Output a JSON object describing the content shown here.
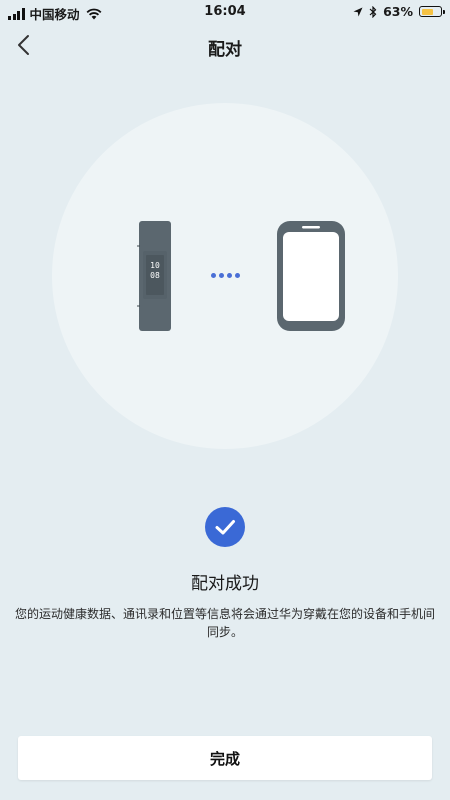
{
  "status_bar": {
    "carrier": "中国移动",
    "time": "16:04",
    "battery": "63%",
    "battery_level": 0.63,
    "icons": [
      "signal-icon",
      "wifi-icon",
      "location-arrow-icon",
      "bluetooth-icon",
      "battery-icon"
    ]
  },
  "nav": {
    "title": "配对",
    "back_icon": "chevron-left-icon"
  },
  "illustration": {
    "device_icon": "smart-band-icon",
    "band_screen_text": "10\n08",
    "connector_icon": "connecting-dots-icon",
    "phone_icon": "smartphone-icon"
  },
  "result": {
    "icon": "check-circle-icon",
    "title": "配对成功",
    "description": "您的运动健康数据、通讯录和位置等信息将会通过华为穿戴在您的设备和手机间同步。"
  },
  "footer": {
    "done_label": "完成"
  },
  "colors": {
    "background": "#e4edf1",
    "accent": "#3a69d6",
    "device_gray": "#5b676f",
    "battery_fill": "#f5c243"
  }
}
